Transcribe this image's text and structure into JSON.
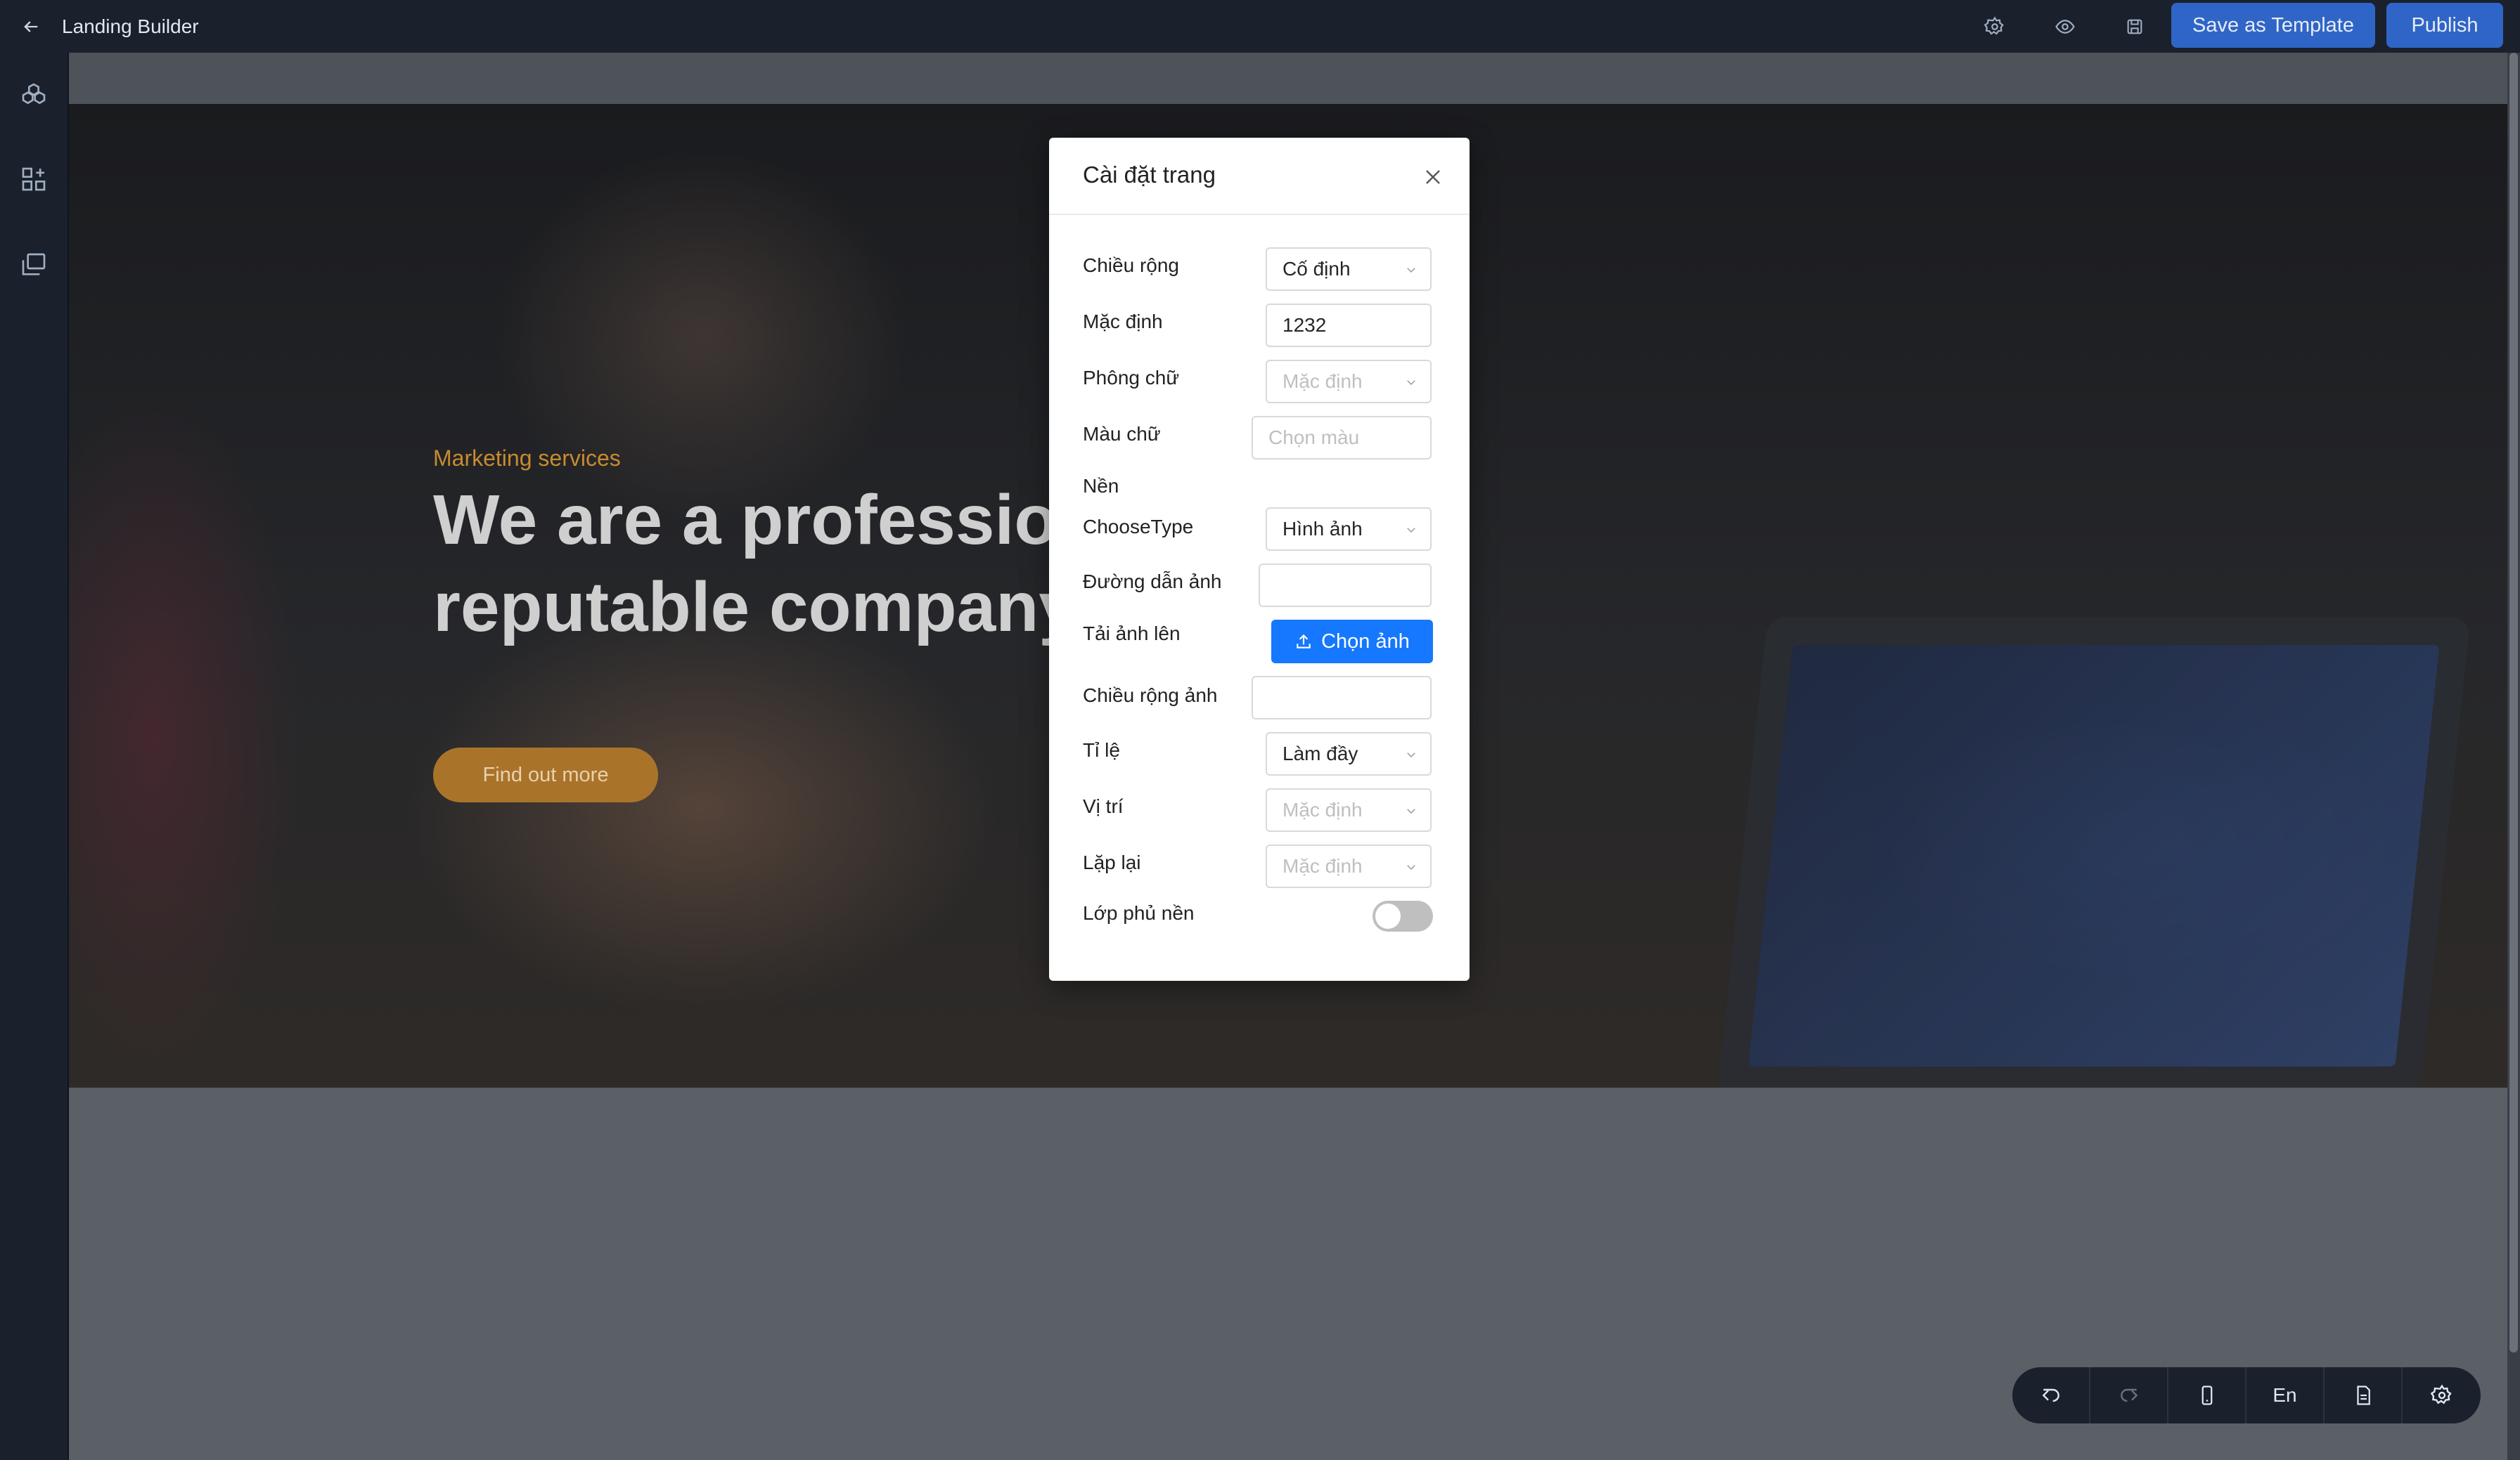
{
  "topbar": {
    "title": "Landing Builder",
    "save_template_label": "Save as Template",
    "publish_label": "Publish"
  },
  "hero": {
    "tagline": "Marketing services",
    "headline": "We are a professional reputable company.",
    "cta_label": "Find out more"
  },
  "modal": {
    "title": "Cài đặt trang",
    "fields": {
      "width_label": "Chiều rộng",
      "width_value": "Cố định",
      "default_label": "Mặc định",
      "default_value": "1232",
      "font_label": "Phông chữ",
      "font_placeholder": "Mặc định",
      "color_label": "Màu chữ",
      "color_placeholder": "Chọn màu",
      "bg_section": "Nền",
      "choose_type_label": "ChooseType",
      "choose_type_value": "Hình ảnh",
      "image_path_label": "Đường dẫn ảnh",
      "upload_label": "Tải ảnh lên",
      "upload_button": "Chọn ảnh",
      "image_width_label": "Chiều rộng ảnh",
      "ratio_label": "Tỉ lệ",
      "ratio_value": "Làm đầy",
      "position_label": "Vị trí",
      "position_placeholder": "Mặc định",
      "repeat_label": "Lặp lại",
      "repeat_placeholder": "Mặc định",
      "overlay_label": "Lớp phủ nền",
      "overlay_enabled": false
    }
  },
  "bottombar": {
    "lang_label": "En"
  }
}
